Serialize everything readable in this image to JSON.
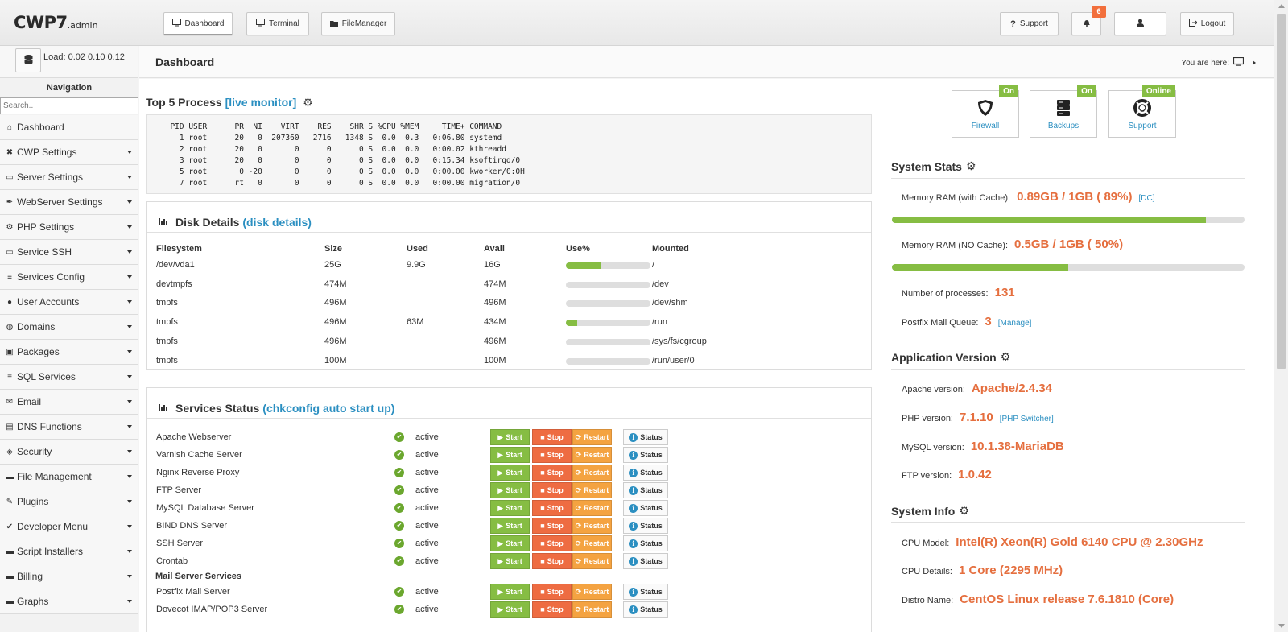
{
  "header": {
    "logo": "CWP7",
    "logo_suffix": ".admin",
    "tabs": [
      {
        "label": "Dashboard",
        "icon": "monitor-icon"
      },
      {
        "label": "Terminal",
        "icon": "monitor-icon"
      },
      {
        "label": "FileManager",
        "icon": "folder-icon"
      }
    ],
    "support_label": "Support",
    "notifications_count": "6",
    "logout_label": "Logout"
  },
  "sidebar": {
    "load_text": "Load: 0.02  0.10  0.12",
    "nav_title": "Navigation",
    "search_placeholder": "Search..",
    "items": [
      {
        "label": "Dashboard",
        "icon": "home-icon",
        "expandable": false
      },
      {
        "label": "CWP Settings",
        "icon": "wrench-icon",
        "expandable": true
      },
      {
        "label": "Server Settings",
        "icon": "monitor-icon",
        "expandable": true
      },
      {
        "label": "WebServer Settings",
        "icon": "feather-icon",
        "expandable": true
      },
      {
        "label": "PHP Settings",
        "icon": "gear-icon",
        "expandable": true
      },
      {
        "label": "Service SSH",
        "icon": "monitor-icon",
        "expandable": true
      },
      {
        "label": "Services Config",
        "icon": "server-icon",
        "expandable": true
      },
      {
        "label": "User Accounts",
        "icon": "user-icon",
        "expandable": true
      },
      {
        "label": "Domains",
        "icon": "globe-icon",
        "expandable": true
      },
      {
        "label": "Packages",
        "icon": "box-icon",
        "expandable": true
      },
      {
        "label": "SQL Services",
        "icon": "database-icon",
        "expandable": true
      },
      {
        "label": "Email",
        "icon": "envelope-icon",
        "expandable": true
      },
      {
        "label": "DNS Functions",
        "icon": "dns-icon",
        "expandable": true
      },
      {
        "label": "Security",
        "icon": "shield-icon",
        "expandable": true
      },
      {
        "label": "File Management",
        "icon": "folder-icon",
        "expandable": true
      },
      {
        "label": "Plugins",
        "icon": "plug-icon",
        "expandable": true
      },
      {
        "label": "Developer Menu",
        "icon": "code-icon",
        "expandable": true
      },
      {
        "label": "Script Installers",
        "icon": "new-icon",
        "expandable": true
      },
      {
        "label": "Billing",
        "icon": "billing-icon",
        "expandable": true
      },
      {
        "label": "Graphs",
        "icon": "graph-icon",
        "expandable": true
      }
    ]
  },
  "content": {
    "page_title": "Dashboard",
    "breadcrumb": "You are here:",
    "top_process": {
      "title": "Top 5 Process",
      "link": "[live monitor]",
      "lines": [
        "  PID USER      PR  NI    VIRT    RES    SHR S %CPU %MEM     TIME+ COMMAND",
        "    1 root      20   0  207360   2716   1348 S  0.0  0.3   0:06.80 systemd",
        "    2 root      20   0       0      0      0 S  0.0  0.0   0:00.02 kthreadd",
        "    3 root      20   0       0      0      0 S  0.0  0.0   0:15.34 ksoftirqd/0",
        "    5 root       0 -20       0      0      0 S  0.0  0.0   0:00.00 kworker/0:0H",
        "    7 root      rt   0       0      0      0 S  0.0  0.0   0:00.00 migration/0"
      ]
    },
    "disk": {
      "title": "Disk Details",
      "link": "(disk details)",
      "headers": [
        "Filesystem",
        "Size",
        "Used",
        "Avail",
        "Use%",
        "Mounted"
      ],
      "rows": [
        {
          "fs": "/dev/vda1",
          "size": "25G",
          "used": "9.9G",
          "avail": "16G",
          "use_pct": 41,
          "mounted": "/"
        },
        {
          "fs": "devtmpfs",
          "size": "474M",
          "used": "",
          "avail": "474M",
          "use_pct": 0,
          "mounted": "/dev"
        },
        {
          "fs": "tmpfs",
          "size": "496M",
          "used": "",
          "avail": "496M",
          "use_pct": 0,
          "mounted": "/dev/shm"
        },
        {
          "fs": "tmpfs",
          "size": "496M",
          "used": "63M",
          "avail": "434M",
          "use_pct": 13,
          "mounted": "/run"
        },
        {
          "fs": "tmpfs",
          "size": "496M",
          "used": "",
          "avail": "496M",
          "use_pct": 0,
          "mounted": "/sys/fs/cgroup"
        },
        {
          "fs": "tmpfs",
          "size": "100M",
          "used": "",
          "avail": "100M",
          "use_pct": 0,
          "mounted": "/run/user/0"
        }
      ]
    },
    "services": {
      "title": "Services Status",
      "link": "(chkconfig auto start up)",
      "btn_start": "Start",
      "btn_stop": "Stop",
      "btn_restart": "Restart",
      "btn_status": "Status",
      "status_text": "active",
      "rows": [
        "Apache Webserver",
        "Varnish Cache Server",
        "Nginx Reverse Proxy",
        "FTP Server",
        "MySQL Database Server",
        "BIND DNS Server",
        "SSH Server",
        "Crontab"
      ],
      "mail_heading": "Mail Server Services",
      "mail_rows": [
        "Postfix Mail Server",
        "Dovecot IMAP/POP3 Server"
      ]
    }
  },
  "right": {
    "quick_links": [
      {
        "label": "Firewall",
        "badge": "On",
        "icon": "shield-icon"
      },
      {
        "label": "Backups",
        "badge": "On",
        "icon": "server-icon"
      },
      {
        "label": "Support",
        "badge": "Online",
        "icon": "lifebuoy-icon"
      }
    ],
    "system_stats": {
      "title": "System Stats",
      "mem_cache_label": "Memory RAM (with Cache):",
      "mem_cache_value": "0.89GB / 1GB ( 89%)",
      "mem_cache_link": "[DC]",
      "mem_cache_pct": 89,
      "mem_nocache_label": "Memory RAM (NO Cache):",
      "mem_nocache_value": "0.5GB / 1GB ( 50%)",
      "mem_nocache_pct": 50,
      "processes_label": "Number of processes:",
      "processes_value": "131",
      "mailq_label": "Postfix Mail Queue:",
      "mailq_value": "3",
      "mailq_link": "[Manage]"
    },
    "app_version": {
      "title": "Application Version",
      "apache_label": "Apache version:",
      "apache_value": "Apache/2.4.34",
      "php_label": "PHP version:",
      "php_value": "7.1.10",
      "php_link": "[PHP Switcher]",
      "mysql_label": "MySQL version:",
      "mysql_value": "10.1.38-MariaDB",
      "ftp_label": "FTP version:",
      "ftp_value": "1.0.42"
    },
    "system_info": {
      "title": "System Info",
      "cpu_model_label": "CPU Model:",
      "cpu_model_value": "Intel(R) Xeon(R) Gold 6140 CPU @ 2.30GHz",
      "cpu_details_label": "CPU Details:",
      "cpu_details_value": "1 Core (2295 MHz)",
      "distro_label": "Distro Name:",
      "distro_value": "CentOS Linux release 7.6.1810 (Core)"
    }
  }
}
